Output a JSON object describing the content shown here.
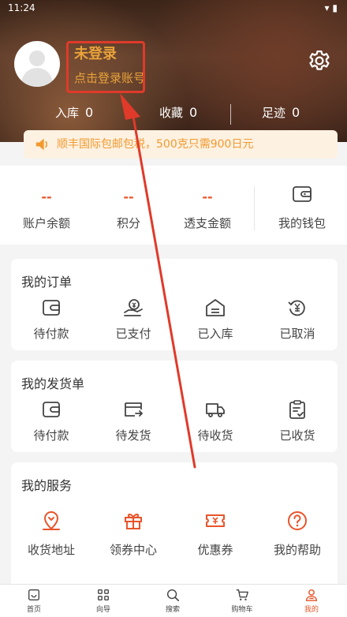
{
  "status_bar": {
    "time": "11:24",
    "icons": "▾ ▮"
  },
  "user": {
    "name": "未登录",
    "login_hint": "点击登录账号"
  },
  "stats": [
    {
      "label": "入库",
      "value": "0"
    },
    {
      "label": "收藏",
      "value": "0"
    },
    {
      "label": "足迹",
      "value": "0"
    }
  ],
  "notice": {
    "text": "顺丰国际包邮包税，500克只需900日元"
  },
  "wallet": {
    "items": [
      {
        "value": "--",
        "label": "账户余额"
      },
      {
        "value": "--",
        "label": "积分"
      },
      {
        "value": "--",
        "label": "透支金额"
      }
    ],
    "my_wallet_label": "我的钱包"
  },
  "orders": {
    "title": "我的订单",
    "items": [
      {
        "label": "待付款",
        "icon": "wallet-icon"
      },
      {
        "label": "已支付",
        "icon": "paid-icon"
      },
      {
        "label": "已入库",
        "icon": "warehouse-icon"
      },
      {
        "label": "已取消",
        "icon": "refund-icon"
      }
    ]
  },
  "shipping": {
    "title": "我的发货单",
    "items": [
      {
        "label": "待付款",
        "icon": "wallet-icon"
      },
      {
        "label": "待发货",
        "icon": "ship-out-icon"
      },
      {
        "label": "待收货",
        "icon": "truck-icon"
      },
      {
        "label": "已收货",
        "icon": "clipboard-check-icon"
      }
    ]
  },
  "services": {
    "title": "我的服务",
    "items": [
      {
        "label": "收货地址",
        "icon": "location-icon"
      },
      {
        "label": "领券中心",
        "icon": "gift-icon"
      },
      {
        "label": "优惠券",
        "icon": "coupon-icon"
      },
      {
        "label": "我的帮助",
        "icon": "help-icon"
      }
    ]
  },
  "bottom_nav": [
    {
      "label": "首页",
      "icon": "home-icon"
    },
    {
      "label": "向导",
      "icon": "grid-icon"
    },
    {
      "label": "搜索",
      "icon": "search-icon"
    },
    {
      "label": "购物车",
      "icon": "cart-icon"
    },
    {
      "label": "我的",
      "icon": "user-icon",
      "active": true
    }
  ],
  "colors": {
    "accent": "#e8542a",
    "notice_text": "#f29a2e",
    "annotation_red": "#e03a2a",
    "login_gold": "#e8a23a"
  }
}
